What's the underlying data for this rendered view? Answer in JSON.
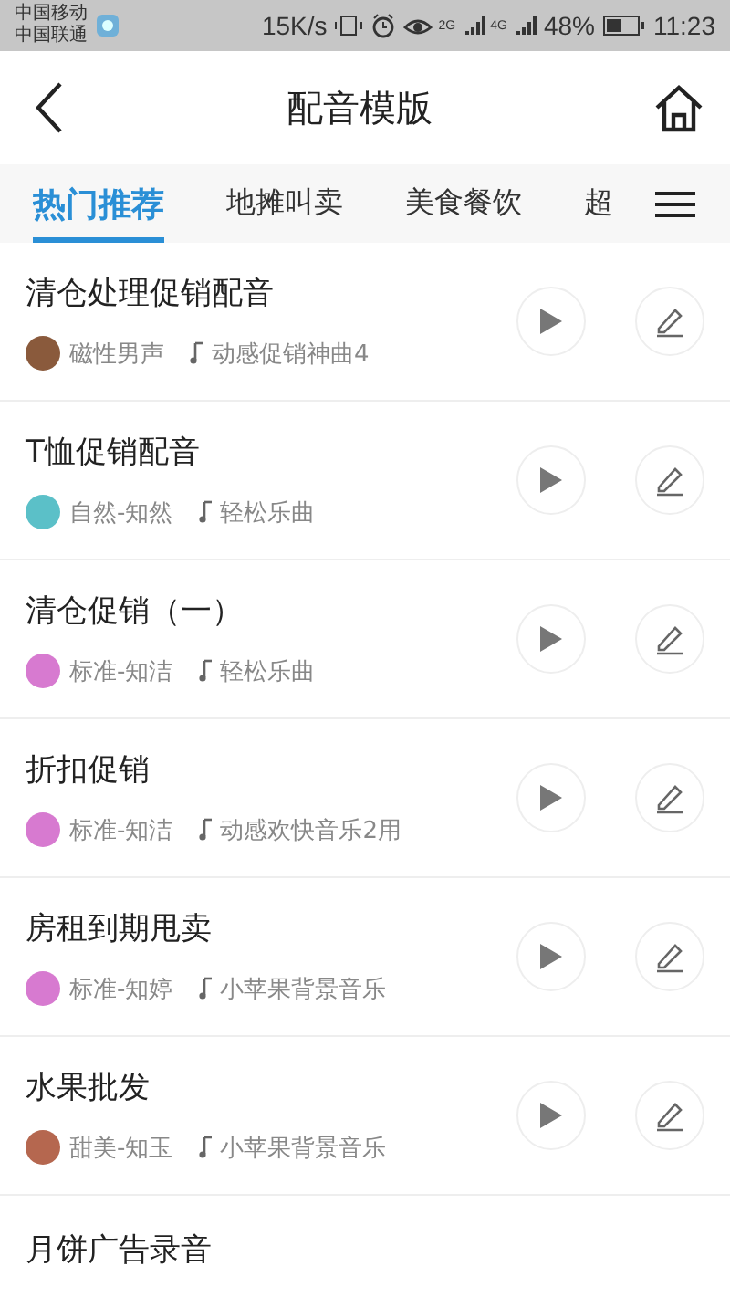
{
  "status_bar": {
    "carriers": [
      "中国移动",
      "中国联通"
    ],
    "speed": "15K/s",
    "signal_1": "2G",
    "signal_2": "4G",
    "battery": "48%",
    "time": "11:23"
  },
  "header": {
    "title": "配音模版"
  },
  "tabs": [
    {
      "label": "热门推荐",
      "selected": true
    },
    {
      "label": "地摊叫卖",
      "selected": false
    },
    {
      "label": "美食餐饮",
      "selected": false
    },
    {
      "label": "超",
      "selected": false
    }
  ],
  "templates": [
    {
      "title": "清仓处理促销配音",
      "voice": "磁性男声",
      "music": "动感促销神曲4",
      "color": "#8a5a3c"
    },
    {
      "title": "T恤促销配音",
      "voice": "自然-知然",
      "music": "轻松乐曲",
      "color": "#5bc0c8"
    },
    {
      "title": "清仓促销（一）",
      "voice": "标准-知洁",
      "music": "轻松乐曲",
      "color": "#d77ad0"
    },
    {
      "title": "折扣促销",
      "voice": "标准-知洁",
      "music": "动感欢快音乐2用",
      "color": "#d77ad0"
    },
    {
      "title": "房租到期甩卖",
      "voice": "标准-知婷",
      "music": "小苹果背景音乐",
      "color": "#d77ad0"
    },
    {
      "title": "水果批发",
      "voice": "甜美-知玉",
      "music": "小苹果背景音乐",
      "color": "#b5674f"
    },
    {
      "title": "月饼广告录音"
    }
  ]
}
